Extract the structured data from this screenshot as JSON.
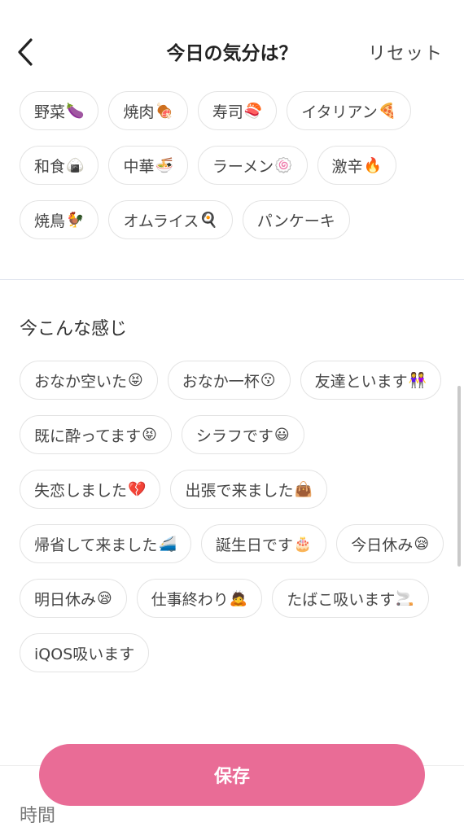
{
  "header": {
    "title": "今日の気分は？",
    "reset_label": "リセット"
  },
  "food_chips": [
    {
      "label": "野菜",
      "emoji": "🍆"
    },
    {
      "label": "焼肉",
      "emoji": "🍖"
    },
    {
      "label": "寿司",
      "emoji": "🍣"
    },
    {
      "label": "イタリアン",
      "emoji": "🍕"
    },
    {
      "label": "和食",
      "emoji": "🍙"
    },
    {
      "label": "中華",
      "emoji": "🍜"
    },
    {
      "label": "ラーメン",
      "emoji": "🍥"
    },
    {
      "label": "激辛",
      "emoji": "🔥"
    },
    {
      "label": "焼鳥",
      "emoji": "🐓"
    },
    {
      "label": "オムライス",
      "emoji": "🍳"
    },
    {
      "label": "パンケーキ",
      "emoji": ""
    }
  ],
  "mood_section": {
    "title": "今こんな感じ"
  },
  "mood_chips": [
    {
      "label": "おなか空いた",
      "emoji": "😝"
    },
    {
      "label": "おなか一杯",
      "emoji": "😗"
    },
    {
      "label": "友達といます",
      "emoji": "👭"
    },
    {
      "label": "既に酔ってます",
      "emoji": "😝"
    },
    {
      "label": "シラフです",
      "emoji": "😃"
    },
    {
      "label": "失恋しました",
      "emoji": "💔"
    },
    {
      "label": "出張で来ました",
      "emoji": "👜"
    },
    {
      "label": "帰省して来ました",
      "emoji": "🚄"
    },
    {
      "label": "誕生日です",
      "emoji": "🎂"
    },
    {
      "label": "今日休み",
      "emoji": "😪"
    },
    {
      "label": "明日休み",
      "emoji": "😪"
    },
    {
      "label": "仕事終わり",
      "emoji": "🙇"
    },
    {
      "label": "たばこ吸います",
      "emoji": "🚬"
    },
    {
      "label": "iQOS吸います",
      "emoji": ""
    }
  ],
  "time_section": {
    "title": "時間"
  },
  "save_label": "保存"
}
